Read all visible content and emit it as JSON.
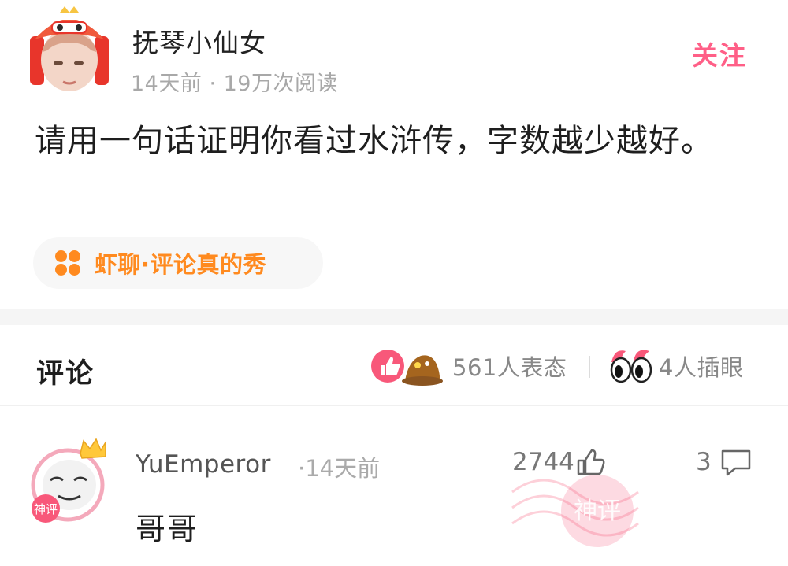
{
  "post": {
    "username": "抚琴小仙女",
    "meta": "14天前 · 19万次阅读",
    "follow_label": "关注",
    "text": "请用一句话证明你看过水浒传，字数越少越好。",
    "tag_label": "虾聊·评论真的秀"
  },
  "comments_header": {
    "title": "评论",
    "reactions_label": "561人表态",
    "eyes_label": "4人插眼"
  },
  "comment": {
    "username": "YuEmperor",
    "time": "·14天前",
    "likes": "2744",
    "replies": "3",
    "text": "哥哥",
    "badge_text": "神评"
  },
  "colors": {
    "accent_pink": "#ff5f87",
    "accent_orange": "#ff8a1f",
    "muted_text": "#a8a8a8"
  },
  "icons": [
    "crown-icon",
    "tag-dots-icon",
    "thumbs-up-reaction-icon",
    "emoji-reaction-icon",
    "eyes-icon",
    "like-icon",
    "reply-icon",
    "shenping-stamp-icon"
  ]
}
